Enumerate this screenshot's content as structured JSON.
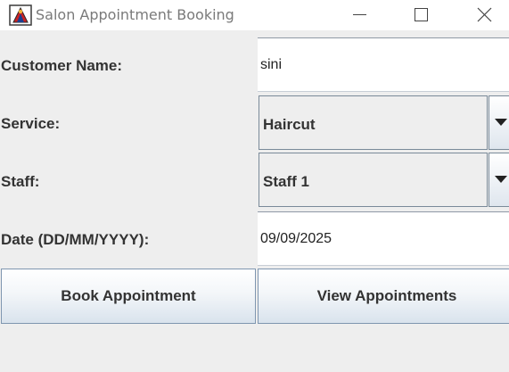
{
  "window": {
    "title": "Salon Appointment Booking",
    "icon": "java-app-icon"
  },
  "form": {
    "customer_name": {
      "label": "Customer Name:",
      "value": "sini"
    },
    "service": {
      "label": "Service:",
      "selected": "Haircut"
    },
    "staff": {
      "label": "Staff:",
      "selected": "Staff 1"
    },
    "date": {
      "label": "Date (DD/MM/YYYY):",
      "value": "09/09/2025"
    }
  },
  "buttons": {
    "book": "Book Appointment",
    "view": "View Appointments"
  },
  "colors": {
    "background": "#eeeeee",
    "border": "#7a8a99",
    "button_gradient_bottom": "#d9e3ed"
  }
}
